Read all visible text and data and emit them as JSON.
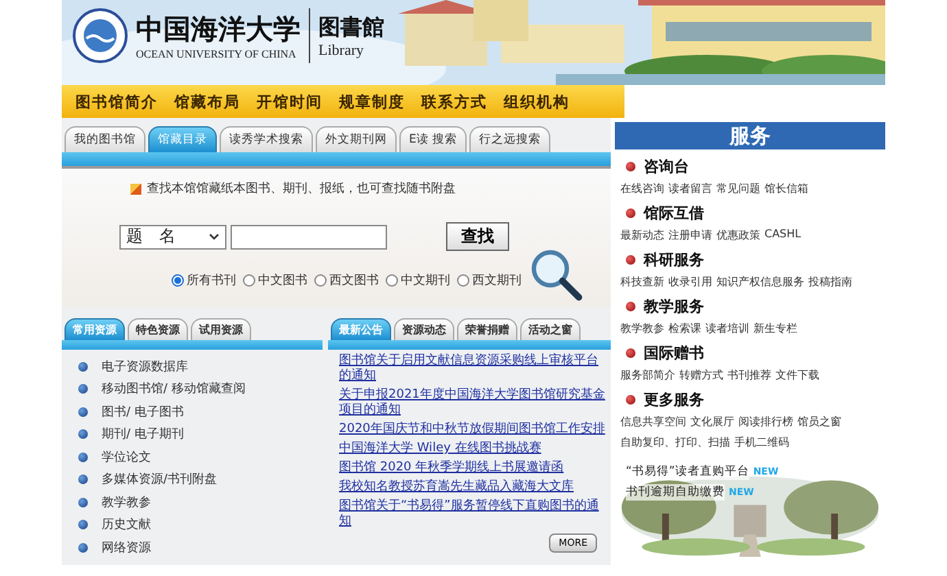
{
  "header": {
    "university_name": "中国海洋大学",
    "library_name": "图書館",
    "university_name_en": "OCEAN UNIVERSITY OF CHINA",
    "library_name_en": "Library"
  },
  "nav": [
    "图书馆简介",
    "馆藏布局",
    "开馆时间",
    "规章制度",
    "联系方式",
    "组织机构"
  ],
  "catalog_tabs": [
    {
      "label": "我的图书馆",
      "selected": false
    },
    {
      "label": "馆藏目录",
      "selected": true
    },
    {
      "label": "读秀学术搜索",
      "selected": false
    },
    {
      "label": "外文期刊网",
      "selected": false
    },
    {
      "label": "E读 搜索",
      "selected": false
    },
    {
      "label": "行之远搜索",
      "selected": false
    }
  ],
  "search": {
    "hint": "查找本馆馆藏纸本图书、期刊、报纸，也可查找随书附盘",
    "field_select": "题　名",
    "button": "查找",
    "scopes": [
      {
        "label": "所有书刊",
        "selected": true
      },
      {
        "label": "中文图书",
        "selected": false
      },
      {
        "label": "西文图书",
        "selected": false
      },
      {
        "label": "中文期刊",
        "selected": false
      },
      {
        "label": "西文期刊",
        "selected": false
      }
    ]
  },
  "resource_tabs": [
    {
      "label": "常用资源",
      "selected": true
    },
    {
      "label": "特色资源",
      "selected": false
    },
    {
      "label": "试用资源",
      "selected": false
    }
  ],
  "resources": [
    "电子资源数据库",
    "移动图书馆/ 移动馆藏查阅",
    "图书/ 电子图书",
    "期刊/ 电子期刊",
    "学位论文",
    "多媒体资源/书刊附盘",
    "教学教参",
    "历史文献",
    "网络资源"
  ],
  "news_tabs": [
    {
      "label": "最新公告",
      "selected": true
    },
    {
      "label": "资源动态",
      "selected": false
    },
    {
      "label": "荣誉捐赠",
      "selected": false
    },
    {
      "label": "活动之窗",
      "selected": false
    }
  ],
  "news": [
    "图书馆关于启用文献信息资源采购线上审核平台的通知",
    "关于申报2021年度中国海洋大学图书馆研究基金项目的通知",
    "2020年国庆节和中秋节放假期间图书馆工作安排",
    "中国海洋大学 Wiley 在线图书挑战赛",
    "图书馆 2020 年秋季学期线上书展邀请函",
    "我校知名教授苏育嵩先生藏品入藏海大文库",
    "图书馆关于“书易得”服务暂停线下直购图书的通知"
  ],
  "more_button": "MORE",
  "services": {
    "title": "服务",
    "groups": [
      {
        "title": "咨询台",
        "links": [
          "在线咨询",
          "读者留言",
          "常见问题",
          "馆长信箱"
        ]
      },
      {
        "title": "馆际互借",
        "links": [
          "最新动态",
          "注册申请",
          "优惠政策",
          "CASHL"
        ]
      },
      {
        "title": "科研服务",
        "links": [
          "科技查新",
          "收录引用",
          "知识产权信息服务",
          "投稿指南"
        ]
      },
      {
        "title": "教学服务",
        "links": [
          "教学教参",
          "检索课",
          "读者培训",
          "新生专栏"
        ]
      },
      {
        "title": "国际赠书",
        "links": [
          "服务部简介",
          "转赠方式",
          "书刊推荐",
          "文件下载"
        ]
      },
      {
        "title": "更多服务",
        "links": [
          "信息共享空间",
          "文化展厅",
          "阅读排行榜",
          "馆员之窗",
          "自助复印、打印、扫描",
          "手机二维码"
        ]
      }
    ]
  },
  "promo": [
    {
      "kind": "link",
      "text": "“书易得”读者直购平台"
    },
    {
      "kind": "badge",
      "text": "NEW"
    },
    {
      "kind": "link",
      "text": "书刊逾期自助缴费"
    },
    {
      "kind": "badge",
      "text": "NEW"
    }
  ]
}
